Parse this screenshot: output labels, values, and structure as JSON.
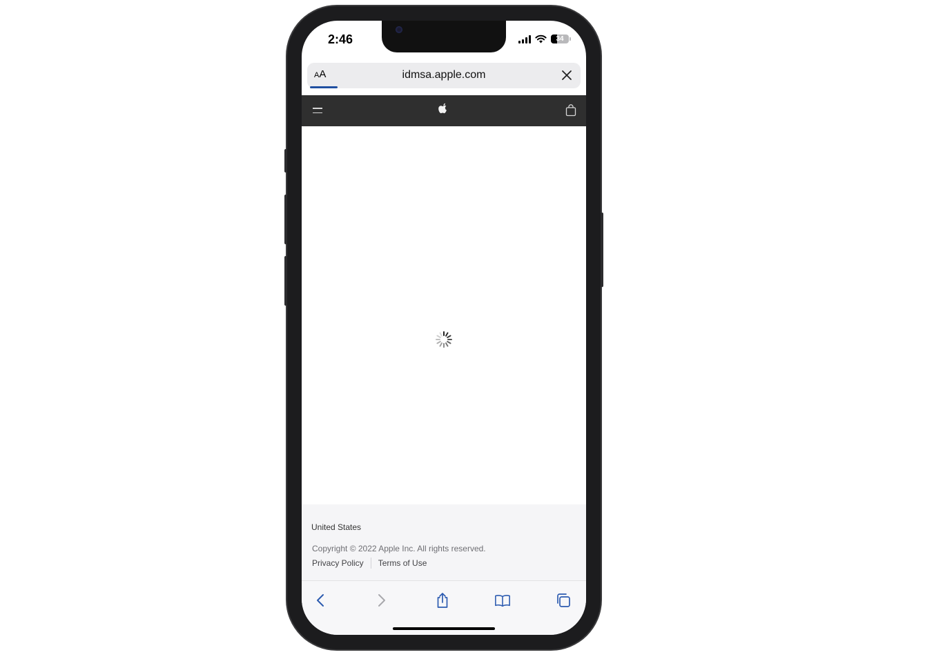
{
  "status_bar": {
    "time": "2:46",
    "battery_level": "34"
  },
  "url_bar": {
    "text_size_label_small": "A",
    "text_size_label_large": "A",
    "url": "idmsa.apple.com",
    "load_progress": 0.1
  },
  "apple_nav": {
    "icons": [
      "menu-icon",
      "apple-logo-icon",
      "shopping-bag-icon"
    ]
  },
  "content": {
    "state": "loading",
    "spinner": "loading-spinner-icon"
  },
  "footer": {
    "country": "United States",
    "copyright": "Copyright © 2022 Apple Inc. All rights reserved.",
    "links": [
      "Privacy Policy",
      "Terms of Use"
    ]
  },
  "toolbar": {
    "icons": [
      "back-icon",
      "forward-icon",
      "share-icon",
      "bookmarks-icon",
      "tabs-icon"
    ]
  },
  "colors": {
    "accent": "#1f4fa0",
    "nav_background": "#2f2f2f",
    "footer_background": "#f5f5f7"
  }
}
